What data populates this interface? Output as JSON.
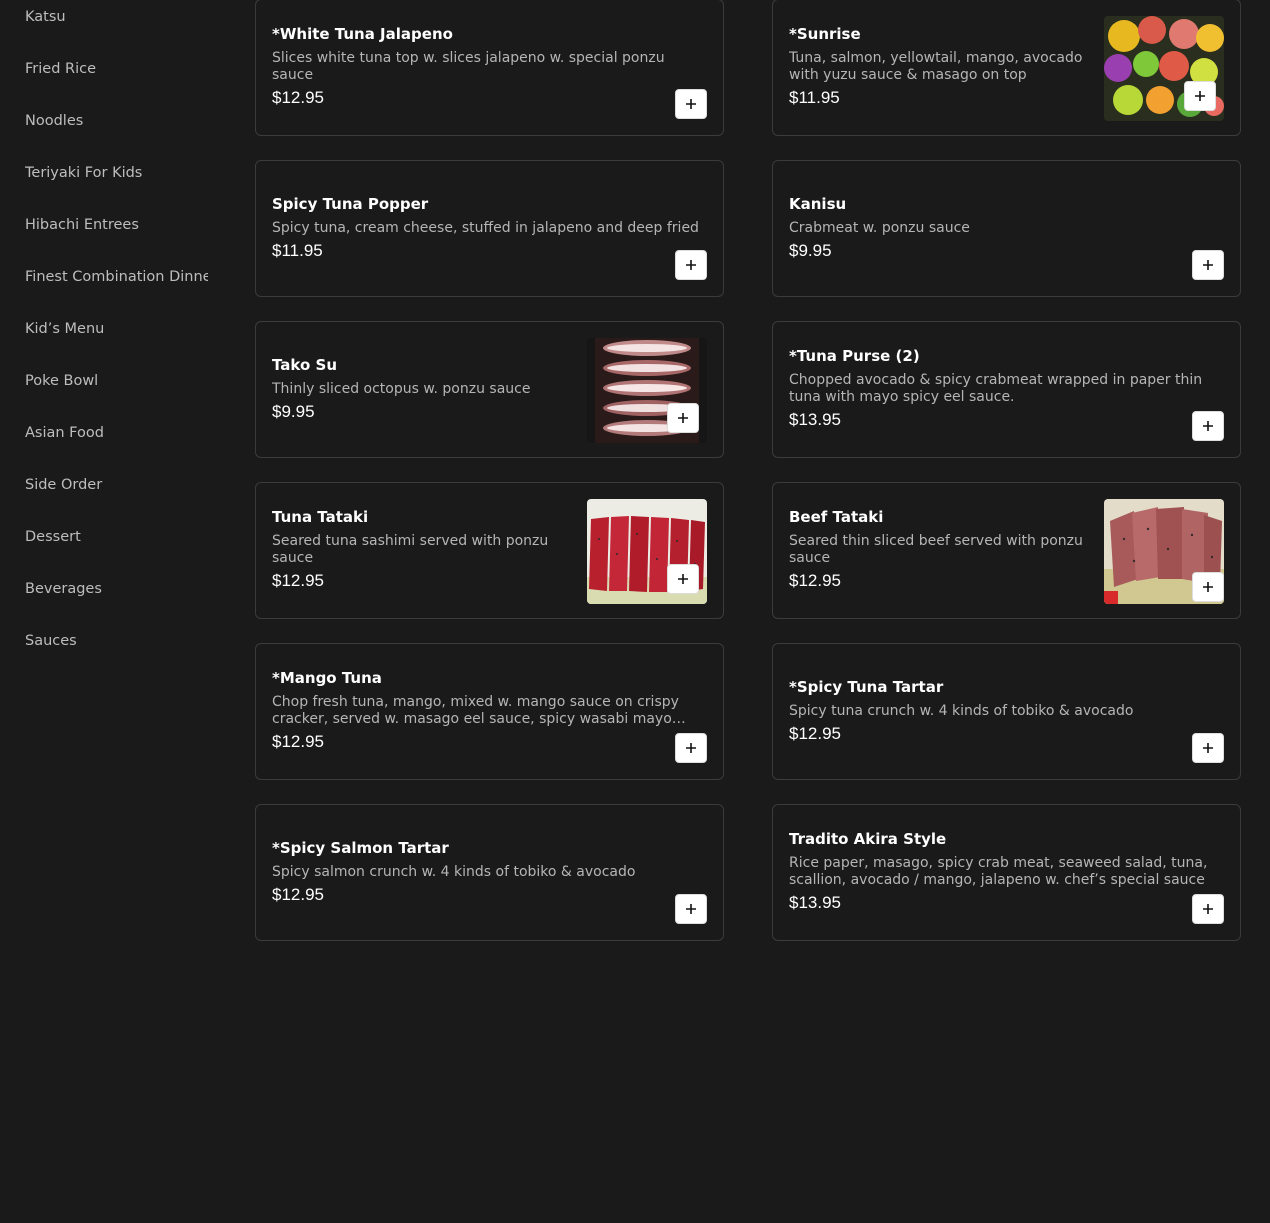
{
  "sidebar": {
    "items": [
      {
        "label": "Katsu"
      },
      {
        "label": "Fried Rice"
      },
      {
        "label": "Noodles"
      },
      {
        "label": "Teriyaki For Kids"
      },
      {
        "label": "Hibachi Entrees"
      },
      {
        "label": "Finest Combination Dinner"
      },
      {
        "label": "Kid’s Menu"
      },
      {
        "label": "Poke Bowl"
      },
      {
        "label": "Asian Food"
      },
      {
        "label": "Side Order"
      },
      {
        "label": "Dessert"
      },
      {
        "label": "Beverages"
      },
      {
        "label": "Sauces"
      }
    ]
  },
  "menu": {
    "items": [
      {
        "name": "*White Tuna Jalapeno",
        "description": "Slices white tuna top w. slices jalapeno w. special ponzu sauce",
        "price": "$12.95"
      },
      {
        "name": "*Sunrise",
        "description": "Tuna, salmon, yellowtail, mango, avocado with yuzu sauce & masago on top",
        "price": "$11.95"
      },
      {
        "name": "Spicy Tuna Popper",
        "description": "Spicy tuna, cream cheese, stuffed in jalapeno and deep fried",
        "price": "$11.95"
      },
      {
        "name": "Kanisu",
        "description": "Crabmeat w. ponzu sauce",
        "price": "$9.95"
      },
      {
        "name": "Tako Su",
        "description": "Thinly sliced octopus w. ponzu sauce",
        "price": "$9.95"
      },
      {
        "name": "*Tuna Purse (2)",
        "description": "Chopped avocado & spicy crabmeat wrapped in paper thin tuna with mayo spicy eel sauce.",
        "price": "$13.95"
      },
      {
        "name": "Tuna Tataki",
        "description": "Seared tuna sashimi served with ponzu sauce",
        "price": "$12.95"
      },
      {
        "name": "Beef Tataki",
        "description": "Seared thin sliced beef served with ponzu sauce",
        "price": "$12.95"
      },
      {
        "name": "*Mango Tuna",
        "description": "Chop fresh tuna, mango, mixed w. mango sauce on crispy cracker, served w. masago eel sauce, spicy wasabi mayo sauce",
        "price": "$12.95"
      },
      {
        "name": "*Spicy Tuna Tartar",
        "description": "Spicy tuna crunch w. 4 kinds of tobiko & avocado",
        "price": "$12.95"
      },
      {
        "name": "*Spicy Salmon Tartar",
        "description": "Spicy salmon crunch w. 4 kinds of tobiko & avocado",
        "price": "$12.95"
      },
      {
        "name": "Tradito Akira Style",
        "description": "Rice paper, masago, spicy crab meat, seaweed salad, tuna, scallion, avocado / mango, jalapeno w. chef’s special sauce",
        "price": "$13.95"
      }
    ]
  },
  "icons": {
    "add": "plus-icon"
  },
  "colors": {
    "background": "#1a1a1a",
    "card_border": "#3b3b3b",
    "text_primary": "#ffffff",
    "text_secondary": "#b5b5b5",
    "button_bg": "#ffffff"
  }
}
